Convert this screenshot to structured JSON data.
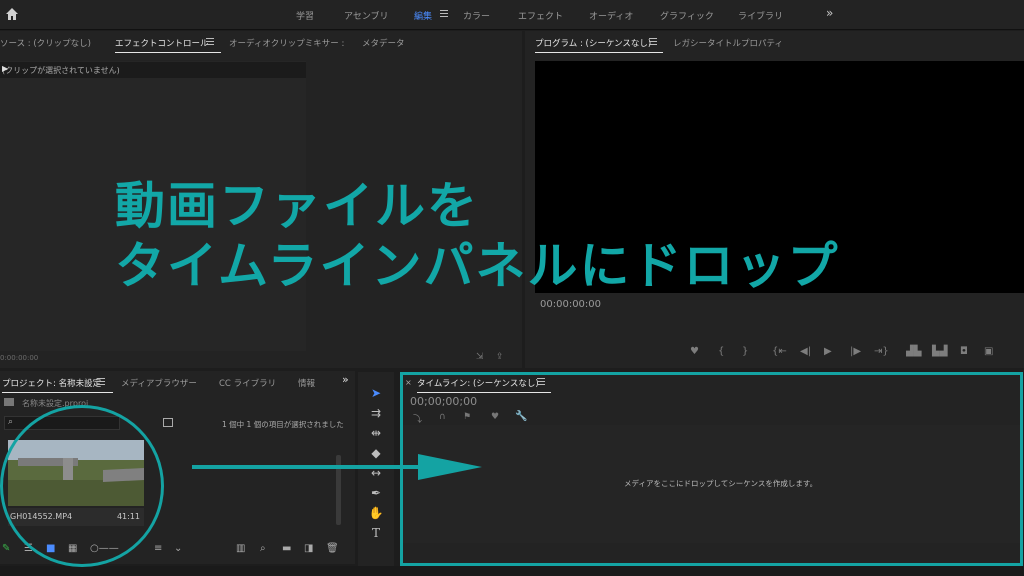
{
  "topbar": {
    "workspaces": [
      "学習",
      "アセンブリ",
      "編集",
      "カラー",
      "エフェクト",
      "オーディオ",
      "グラフィック",
      "ライブラリ"
    ],
    "active": "編集",
    "more": "»"
  },
  "source_panel": {
    "tabs": [
      "ソース : (クリップなし)",
      "エフェクトコントロール",
      "オーディオクリップミキサー :",
      "メタデータ"
    ],
    "no_clip": "(クリップが選択されていません)",
    "timecode": "0:00:00:00"
  },
  "program_panel": {
    "tabs": [
      "プログラム : (シーケンスなし)",
      "レガシータイトルプロパティ"
    ],
    "timecode": "00:00:00:00"
  },
  "project_panel": {
    "tabs": [
      "プロジェクト: 名称未設定",
      "メディアブラウザー",
      "CC ライブラリ",
      "情報"
    ],
    "file_name": "名称未設定.prproj",
    "selection_info": "1 個中 1 個の項目が選択されました",
    "clip_name": "GH014552.MP4",
    "clip_duration": "41:11"
  },
  "timeline_panel": {
    "title": "タイムライン: (シーケンスなし)",
    "timecode": "00;00;00;00",
    "drop_message": "メディアをここにドロップしてシーケンスを作成します。"
  },
  "overlay": {
    "line1": "動画ファイルを",
    "line2": "タイムラインパネルにドロップ"
  },
  "colors": {
    "accent_teal": "#14a3a3",
    "active_blue": "#4b8cff"
  }
}
